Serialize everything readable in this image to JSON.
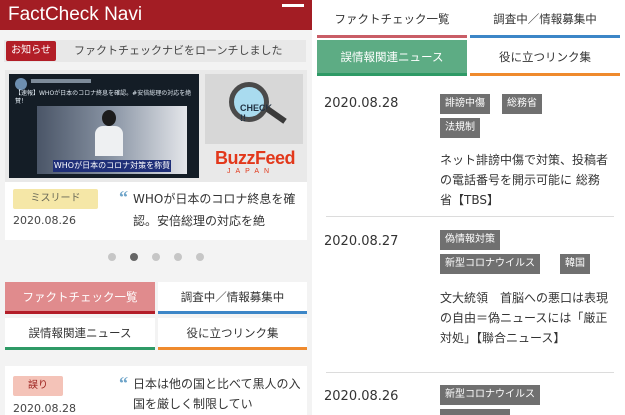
{
  "left": {
    "site_title": "FactCheck Navi",
    "news": {
      "badge": "お知らせ",
      "text": "ファクトチェックナビをローンチしました"
    },
    "slide": {
      "tweet_text": "【速報】WHOが日本のコロナ終息を確認。#安倍総理の対応を絶賛！",
      "video_caption": "WHOが日本のコロナ対策を称賛",
      "magnifier_label": "CHECK !!",
      "logo": "BuzzFeed",
      "logo_sub": "JAPAN",
      "tag": "ミスリード",
      "date": "2020.08.26",
      "quote_mark": "“",
      "title": "WHOが日本のコロナ終息を確認。安倍総理の対応を絶"
    },
    "dots": {
      "count": 5,
      "active": 1
    },
    "nav": [
      {
        "label": "ファクトチェック一覧"
      },
      {
        "label": "調査中／情報募集中"
      },
      {
        "label": "誤情報関連ニュース"
      },
      {
        "label": "役に立つリンク集"
      }
    ],
    "bottom": {
      "tag": "誤り",
      "date": "2020.08.28",
      "quote_mark": "“",
      "title": "日本は他の国と比べて黒人の入国を厳しく制限してい"
    }
  },
  "right": {
    "nav": [
      {
        "label": "ファクトチェック一覧"
      },
      {
        "label": "調査中／情報募集中"
      },
      {
        "label": "誤情報関連ニュース"
      },
      {
        "label": "役に立つリンク集"
      }
    ],
    "articles": [
      {
        "date": "2020.08.28",
        "tags": [
          "誹謗中傷",
          "総務省",
          "法規制"
        ],
        "title": "ネット誹謗中傷で対策、投稿者の電話番号を開示可能に 総務省【TBS】"
      },
      {
        "date": "2020.08.27",
        "tags": [
          "偽情報対策",
          "新型コロナウイルス",
          "韓国"
        ],
        "title": "文大統領　首脳への悪口は表現の自由＝偽ニュースには「厳正対処」【聯合ニュース】"
      },
      {
        "date": "2020.08.26",
        "tags": [
          "新型コロナウイルス"
        ],
        "title": ""
      }
    ]
  }
}
